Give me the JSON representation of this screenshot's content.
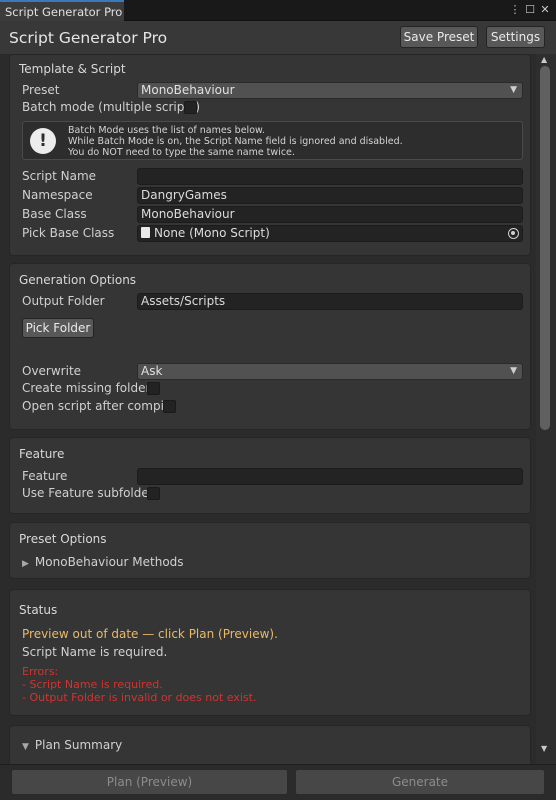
{
  "window": {
    "tab_label": "Script Generator Pro",
    "menu_glyph": "⋮",
    "maximize_glyph": "☐",
    "close_glyph": "✕"
  },
  "header": {
    "title": "Script Generator Pro",
    "save_preset_label": "Save Preset",
    "settings_label": "Settings"
  },
  "template_script": {
    "title": "Template & Script",
    "preset_label": "Preset",
    "preset_value": "MonoBehaviour",
    "batch_label": "Batch mode (multiple scripts)",
    "help_icon_glyph": "!",
    "help_lines": [
      "Batch Mode uses the list of names below.",
      "While Batch Mode is on, the Script Name field is ignored and disabled.",
      "You do NOT need to type the same name twice."
    ],
    "script_name_label": "Script Name",
    "script_name_value": "",
    "namespace_label": "Namespace",
    "namespace_value": "DangryGames",
    "base_class_label": "Base Class",
    "base_class_value": "MonoBehaviour",
    "pick_base_class_label": "Pick Base Class",
    "pick_base_class_value": "None (Mono Script)"
  },
  "generation_options": {
    "title": "Generation Options",
    "output_folder_label": "Output Folder",
    "output_folder_value": "Assets/Scripts",
    "pick_folder_label": "Pick Folder",
    "overwrite_label": "Overwrite",
    "overwrite_value": "Ask",
    "create_missing_label": "Create missing folders",
    "open_script_label": "Open script after compile"
  },
  "feature": {
    "title": "Feature",
    "feature_label": "Feature",
    "feature_value": "",
    "use_subfolder_label": "Use Feature subfolder"
  },
  "preset_options": {
    "title": "Preset Options",
    "foldout_label": "MonoBehaviour Methods",
    "foldout_glyph": "▶"
  },
  "status": {
    "title": "Status",
    "warning": "Preview out of date — click Plan (Preview).",
    "message": "Script Name is required.",
    "errors_header": "Errors:",
    "errors": [
      "- Script Name is required.",
      "- Output Folder is invalid or does not exist."
    ]
  },
  "plan_summary": {
    "foldout_label": "Plan Summary",
    "foldout_glyph": "▼"
  },
  "footer": {
    "plan_label": "Plan (Preview)",
    "generate_label": "Generate"
  },
  "scrollbar": {
    "up_glyph": "▲",
    "down_glyph": "▼"
  },
  "colors": {
    "accent_tab": "#3a79bb",
    "warning_text": "#e9b968",
    "error_text": "#d3332f"
  }
}
